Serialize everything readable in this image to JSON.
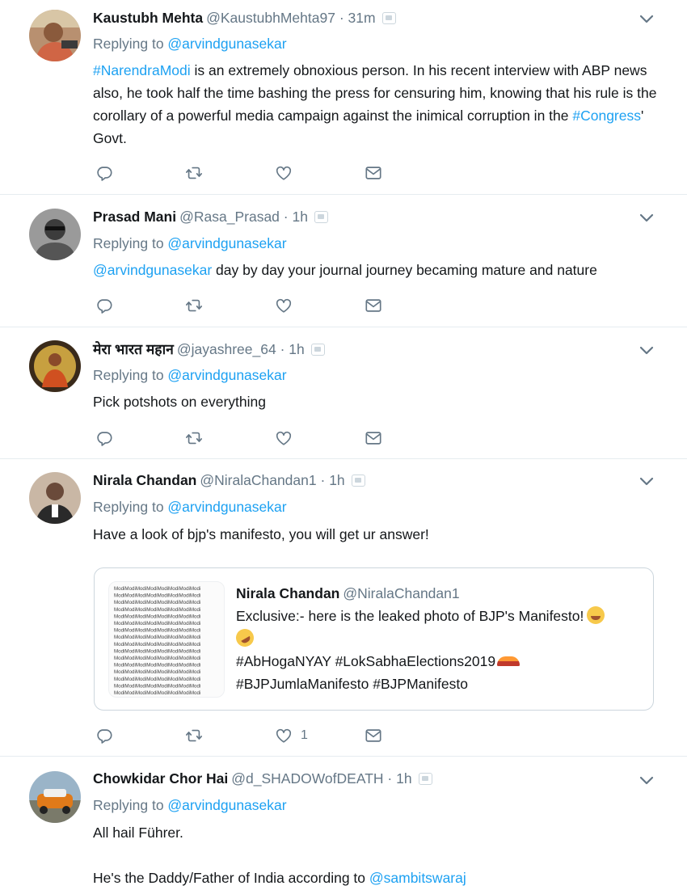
{
  "colors": {
    "link": "#1da1f2",
    "muted": "#657786",
    "icon": "#657786",
    "divider": "#e6ecf0"
  },
  "tweets": [
    {
      "name": "Kaustubh Mehta",
      "handle": "@KaustubhMehta97",
      "dot": "·",
      "time": "31m",
      "reply_prefix": "Replying to ",
      "reply_handle": "@arvindgunasekar",
      "text_parts": [
        "#NarendraModi",
        " is an extremely obnoxious person. In his recent interview with ABP news also, he took half the time bashing the press for censuring him, knowing that his rule is the corollary of a powerful media campaign against the inimical corruption in the ",
        "#Congress",
        "' Govt."
      ],
      "avatar_icon": "avatar-photo"
    },
    {
      "name": "Prasad Mani",
      "handle": "@Rasa_Prasad",
      "dot": "·",
      "time": "1h",
      "reply_prefix": "Replying to ",
      "reply_handle": "@arvindgunasekar",
      "text_parts": [
        "@arvindgunasekar",
        " day by day your journal journey becaming mature and nature"
      ],
      "avatar_icon": "avatar-photo"
    },
    {
      "name": "मेरा भारत महान",
      "handle": "@jayashree_64",
      "dot": "·",
      "time": "1h",
      "reply_prefix": "Replying to ",
      "reply_handle": "@arvindgunasekar",
      "text_parts": [
        "Pick potshots on everything"
      ],
      "avatar_icon": "avatar-photo"
    },
    {
      "name": "Nirala Chandan",
      "handle": "@NiralaChandan1",
      "dot": "·",
      "time": "1h",
      "reply_prefix": "Replying to ",
      "reply_handle": "@arvindgunasekar",
      "text_parts": [
        "Have a look of bjp's manifesto, you will get ur answer!"
      ],
      "like_count": "1",
      "avatar_icon": "avatar-photo",
      "quote": {
        "name": "Nirala Chandan",
        "handle": "@NiralaChandan1",
        "line1": "Exclusive:- here is the leaked photo of BJP's Manifesto!",
        "line3": "#AbHogaNYAY #LokSabhaElections2019",
        "line4": "#BJPJumlaManifesto #BJPManifesto",
        "image_word": "Modi"
      }
    },
    {
      "name": "Chowkidar Chor Hai",
      "handle": "@d_SHADOWofDEATH",
      "dot": "·",
      "time": "1h",
      "reply_prefix": "Replying to ",
      "reply_handle": "@arvindgunasekar",
      "text_line1": "All hail Führer.",
      "text_line2_prefix": "He's the Daddy/Father of India according to ",
      "text_line2_handle": "@sambitswaraj",
      "avatar_icon": "avatar-photo"
    }
  ],
  "icons": [
    "reply-icon",
    "retweet-icon",
    "like-icon",
    "dm-icon",
    "caret-down-icon",
    "gear-icon"
  ]
}
